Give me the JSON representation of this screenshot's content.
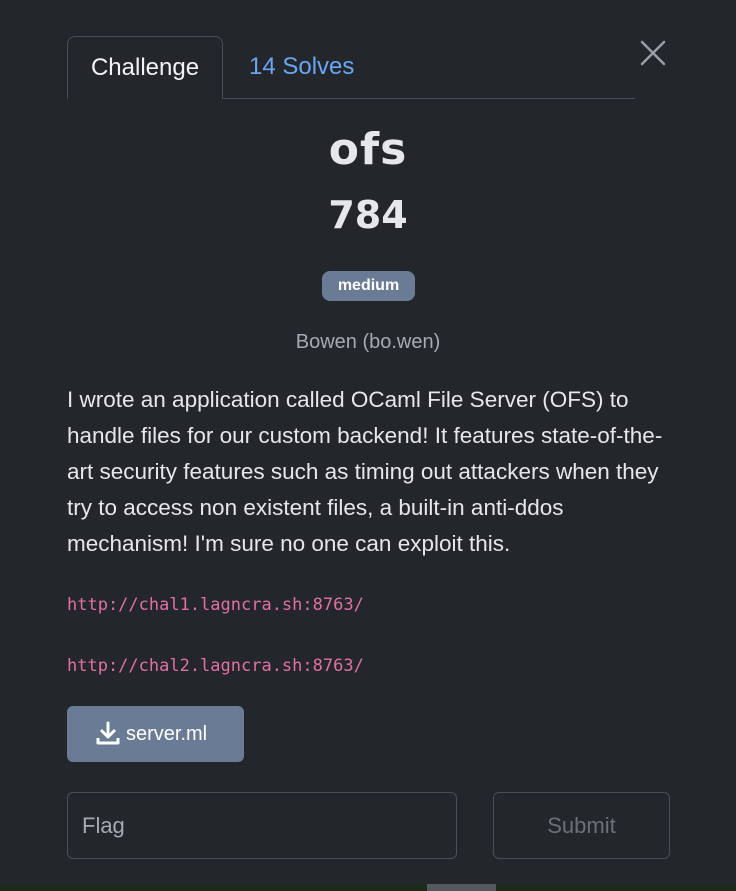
{
  "tabs": {
    "challenge_label": "Challenge",
    "solves_label": "14 Solves"
  },
  "challenge": {
    "name": "ofs",
    "points": "784",
    "difficulty": "medium",
    "author": "Bowen (bo.wen)",
    "description": "I wrote an application called OCaml File Server (OFS) to handle files for our custom backend! It features state-of-the-art security features such as timing out attackers when they try to access non existent files, a built-in anti-ddos mechanism! I'm sure no one can exploit this.",
    "links": [
      "http://chal1.lagncra.sh:8763/",
      "http://chal2.lagncra.sh:8763/"
    ],
    "file_name": "server.ml"
  },
  "form": {
    "flag_placeholder": "Flag",
    "submit_label": "Submit"
  },
  "icons": {
    "close": "close-icon",
    "download": "download-icon"
  },
  "colors": {
    "background": "#23262b",
    "badge": "#6a7b95",
    "link": "#e36fa5",
    "solves_tab": "#6aa6f5"
  }
}
